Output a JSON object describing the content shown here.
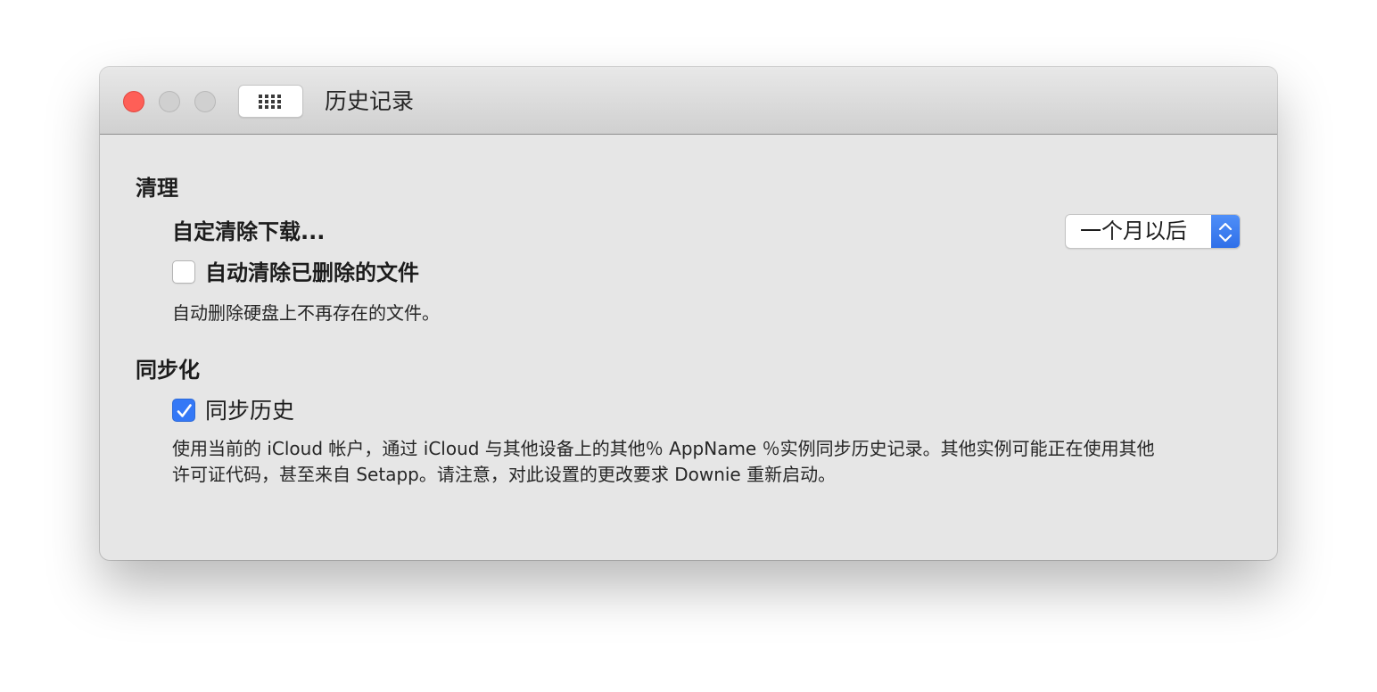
{
  "window": {
    "title": "历史记录"
  },
  "icons": {
    "close": "close-icon",
    "minimize": "minimize-icon",
    "zoom": "zoom-icon",
    "grid": "grid-icon",
    "chevron": "chevron-up-down-icon",
    "check": "checkmark-icon"
  },
  "colors": {
    "accent": "#3478f6",
    "close": "#fe5f57"
  },
  "cleanup": {
    "title": "清理",
    "auto_clear_label": "自定清除下载...",
    "auto_clear_value": "一个月以后",
    "delete_missing_label": "自动清除已删除的文件",
    "delete_missing_checked": false,
    "delete_missing_description": "自动删除硬盘上不再存在的文件。"
  },
  "sync": {
    "title": "同步化",
    "sync_history_label": "同步历史",
    "sync_history_checked": true,
    "description_line1": "使用当前的 iCloud 帐户，通过 iCloud 与其他设备上的其他％ AppName ％实例同步历史记录。其他实例可能正在使用其他",
    "description_line2": "许可证代码，甚至来自 Setapp。请注意，对此设置的更改要求 Downie 重新启动。"
  }
}
